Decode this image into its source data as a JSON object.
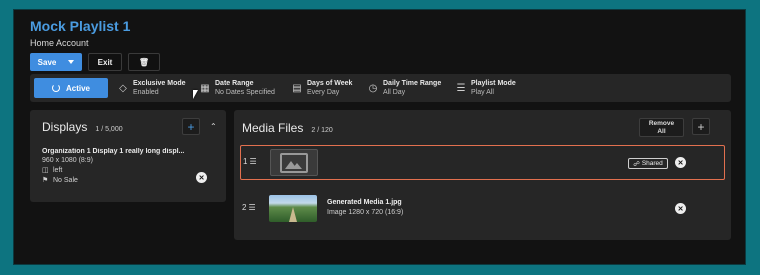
{
  "header": {
    "title": "Mock Playlist 1",
    "subtitle": "Home Account",
    "save_label": "Save",
    "exit_label": "Exit"
  },
  "infobar": {
    "active_label": "Active",
    "items": [
      {
        "label": "Exclusive Mode",
        "value": "Enabled",
        "icon": "gem-icon"
      },
      {
        "label": "Date Range",
        "value": "No Dates Specified",
        "icon": "calendar-icon"
      },
      {
        "label": "Days of Week",
        "value": "Every Day",
        "icon": "calendar-week-icon"
      },
      {
        "label": "Daily Time Range",
        "value": "All Day",
        "icon": "clock-icon"
      },
      {
        "label": "Playlist Mode",
        "value": "Play All",
        "icon": "list-icon"
      }
    ]
  },
  "displays": {
    "title": "Displays",
    "count": "1 / 5,000",
    "items": [
      {
        "name": "Organization 1 Display 1 really long displ...",
        "resolution": "960 x 1080 (8:9)",
        "orientation": "left",
        "sale": "No Sale"
      }
    ]
  },
  "media": {
    "title": "Media Files",
    "count": "2 / 120",
    "remove_all_line1": "Remove",
    "remove_all_line2": "All",
    "rows": [
      {
        "index": "1",
        "shared_label": "Shared"
      },
      {
        "index": "2",
        "name": "Generated Media 1.jpg",
        "info": "Image  1280 x 720 (16:9)"
      }
    ]
  },
  "colors": {
    "accent": "#3f8de0",
    "title": "#4a9be0",
    "selected_border": "#e2704f",
    "background": "#0d7480"
  }
}
